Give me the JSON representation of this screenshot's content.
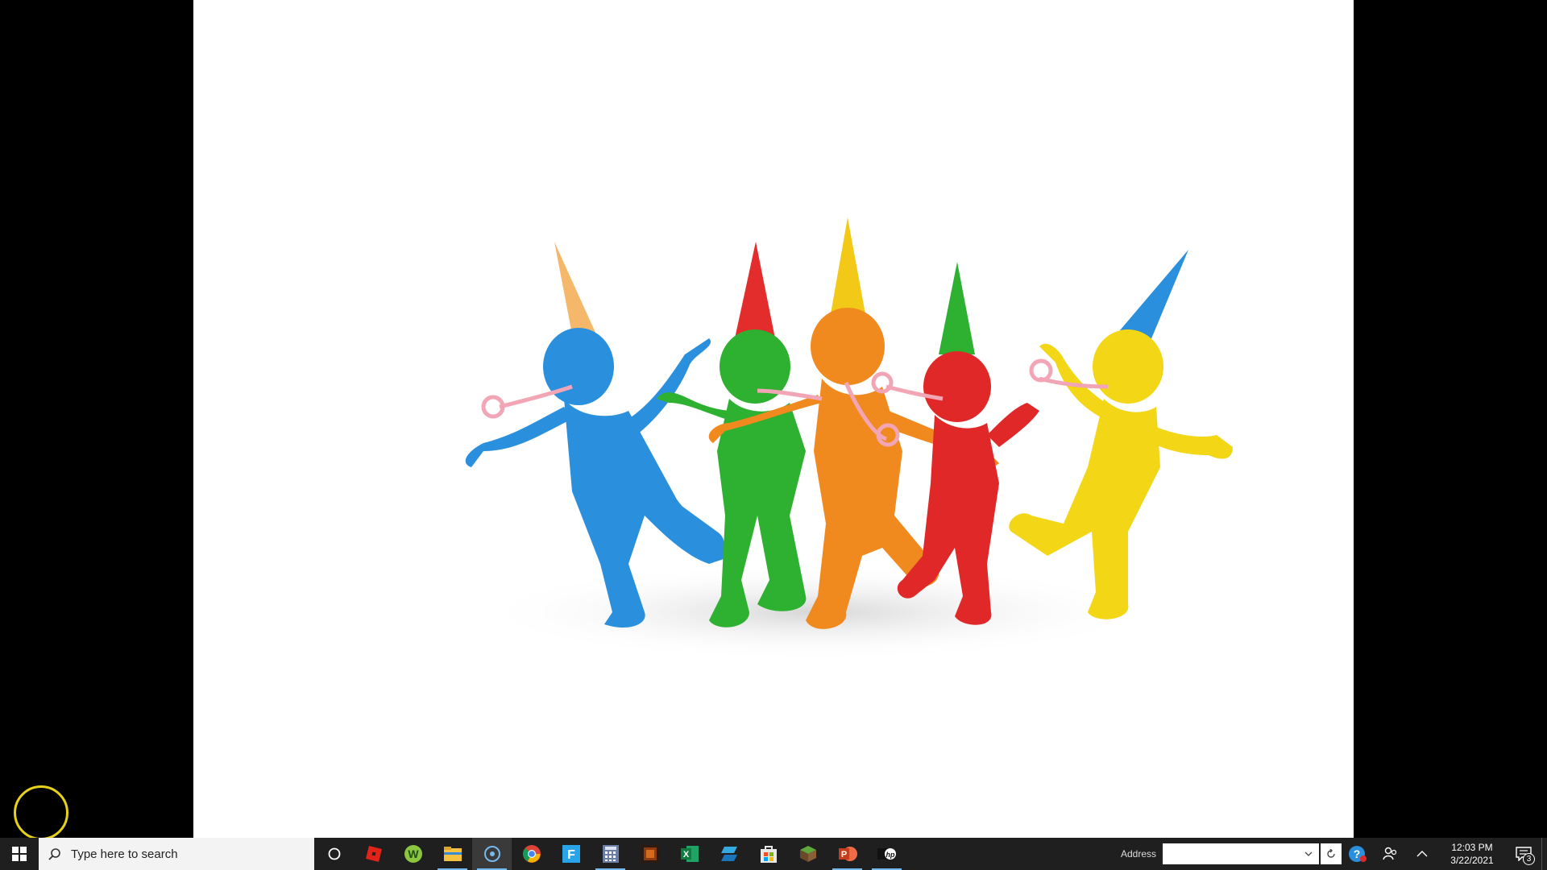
{
  "taskbar": {
    "search_placeholder": "Type here to search",
    "apps": [
      {
        "name": "task-view-icon"
      },
      {
        "name": "roblox-icon"
      },
      {
        "name": "w-app-icon"
      },
      {
        "name": "file-explorer-icon"
      },
      {
        "name": "cortana-icon"
      },
      {
        "name": "chrome-icon"
      },
      {
        "name": "f-app-icon"
      },
      {
        "name": "calculator-icon"
      },
      {
        "name": "minecraft-dungeons-icon"
      },
      {
        "name": "excel-icon"
      },
      {
        "name": "azure-icon"
      },
      {
        "name": "store-icon"
      },
      {
        "name": "minecraft-icon"
      },
      {
        "name": "powerpoint-icon"
      },
      {
        "name": "hp-icon"
      }
    ],
    "address_label": "Address",
    "clock_time": "12:03 PM",
    "clock_date": "3/22/2021",
    "notification_count": "3"
  },
  "colors": {
    "taskbar_bg": "#1f1f1f",
    "accent": "#76b9ed",
    "cursor_ring": "#e6d21a"
  }
}
